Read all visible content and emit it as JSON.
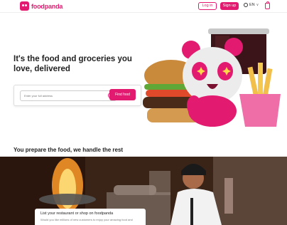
{
  "header": {
    "brand": "foodpanda",
    "login_label": "Log in",
    "signup_label": "Sign up",
    "language": "EN",
    "brand_color": "#e21b70"
  },
  "hero": {
    "title": "It's the food and groceries you love, delivered",
    "search": {
      "placeholder": "Enter your full address",
      "value": ""
    },
    "find_button": "Find food"
  },
  "section": {
    "title": "You prepare the food, we handle the rest"
  },
  "card": {
    "title": "List your restaurant or shop on foodpanda",
    "body": "Would you like millions of new customers to enjoy your amazing food and"
  },
  "icons": [
    "panda-logo-icon",
    "globe-icon",
    "chevron-down-icon",
    "shopping-bag-icon",
    "locate-icon"
  ]
}
